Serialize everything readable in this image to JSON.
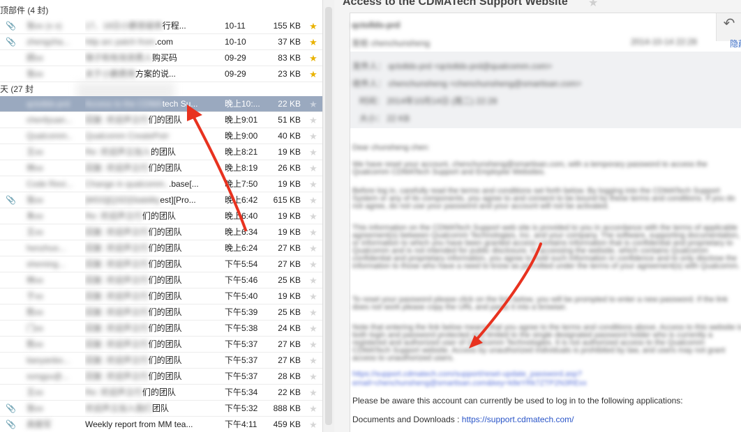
{
  "mail_list": {
    "groups": [
      {
        "label": "顶部件 (4 封)"
      },
      {
        "label": "天 (27 封"
      }
    ],
    "rows": [
      {
        "attach": true,
        "sender": "张xx (x x)",
        "subject_blur": "17、18日小鹏答疑表",
        "subject": "行程...",
        "date": "10-11",
        "size": "155 KB",
        "star": true
      },
      {
        "attach": true,
        "sender": "zhengzha...",
        "subject_blur": "http arc patch from",
        "subject": ".com",
        "date": "10-10",
        "size": "37 KB",
        "star": true
      },
      {
        "attach": false,
        "sender": "顾xx",
        "subject_blur": "锦子和有效资费人",
        "subject": "购买码",
        "date": "09-29",
        "size": "83 KB",
        "star": true
      },
      {
        "attach": false,
        "sender": "张xx",
        "subject_blur": "关于小鹏费用",
        "subject": "方案的说...",
        "date": "09-29",
        "size": "23 KB",
        "star": true
      },
      {
        "attach": false,
        "sender": "qctollds-prd",
        "subject_blur": "Access to the CDMA",
        "subject": "tech Su...",
        "date": "晚上10:...",
        "size": "22 KB",
        "star": false,
        "selected": true
      },
      {
        "attach": false,
        "sender": "chenfyuan...",
        "subject_blur": "回复: 欢迎声立行",
        "subject": "们的团队",
        "date": "晚上9:01",
        "size": "51 KB",
        "star": false
      },
      {
        "attach": false,
        "sender": "Qualcomm...",
        "subject_blur": "Qualcomm CreatePoint中的...",
        "subject": "",
        "date": "晚上9:00",
        "size": "40 KB",
        "star": false
      },
      {
        "attach": false,
        "sender": "王xx",
        "subject_blur": "Re: 欢迎声立加入",
        "subject": "的团队",
        "date": "晚上8:21",
        "size": "19 KB",
        "star": false
      },
      {
        "attach": false,
        "sender": "林xx",
        "subject_blur": "回复: 欢迎声立行",
        "subject": "们的团队",
        "date": "晚上8:19",
        "size": "26 KB",
        "star": false
      },
      {
        "attach": false,
        "sender": "Code Revi...",
        "subject_blur": "Change in qualcomm...",
        "subject": ".base[...",
        "date": "晚上7:50",
        "size": "19 KB",
        "star": false
      },
      {
        "attach": true,
        "sender": "张xx",
        "subject_blur": "[MSS][QSD]Stability",
        "subject": "est][Pro...",
        "date": "晚上6:42",
        "size": "615 KB",
        "star": false
      },
      {
        "attach": false,
        "sender": "朱xx",
        "subject_blur": "Re: 欢迎声立行",
        "subject": "们的团队",
        "date": "晚上6:40",
        "size": "19 KB",
        "star": false
      },
      {
        "attach": false,
        "sender": "王xx",
        "subject_blur": "回复: 欢迎声立行",
        "subject": "们的团队",
        "date": "晚上6:34",
        "size": "19 KB",
        "star": false
      },
      {
        "attach": false,
        "sender": "henzhuo...",
        "subject_blur": "回复: 欢迎声立行",
        "subject": "们的团队",
        "date": "晚上6:24",
        "size": "27 KB",
        "star": false
      },
      {
        "attach": false,
        "sender": "sheming...",
        "subject_blur": "回复: 欢迎声立行",
        "subject": "们的团队",
        "date": "下午5:54",
        "size": "27 KB",
        "star": false
      },
      {
        "attach": false,
        "sender": "林xx",
        "subject_blur": "回复: 欢迎声立行",
        "subject": "们的团队",
        "date": "下午5:46",
        "size": "25 KB",
        "star": false
      },
      {
        "attach": false,
        "sender": "于xx",
        "subject_blur": "回复: 欢迎声立行",
        "subject": "们的团队",
        "date": "下午5:40",
        "size": "19 KB",
        "star": false
      },
      {
        "attach": false,
        "sender": "陈xx",
        "subject_blur": "回复: 欢迎声立行",
        "subject": "们的团队",
        "date": "下午5:39",
        "size": "25 KB",
        "star": false
      },
      {
        "attach": false,
        "sender": "门xx",
        "subject_blur": "回复: 欢迎声立行",
        "subject": "们的团队",
        "date": "下午5:38",
        "size": "24 KB",
        "star": false
      },
      {
        "attach": false,
        "sender": "陈xx",
        "subject_blur": "回复: 欢迎声立行",
        "subject": "们的团队",
        "date": "下午5:37",
        "size": "27 KB",
        "star": false
      },
      {
        "attach": false,
        "sender": "tianyanbo...",
        "subject_blur": "回复: 欢迎声立行",
        "subject": "们的团队",
        "date": "下午5:37",
        "size": "27 KB",
        "star": false
      },
      {
        "attach": false,
        "sender": "songyu@...",
        "subject_blur": "回复: 欢迎声立行",
        "subject": "们的团队",
        "date": "下午5:37",
        "size": "28 KB",
        "star": false
      },
      {
        "attach": false,
        "sender": "王xx",
        "subject_blur": "Re: 欢迎声立行",
        "subject": "们的团队",
        "date": "下午5:34",
        "size": "22 KB",
        "star": false
      },
      {
        "attach": true,
        "sender": "张xx",
        "subject_blur": "欢迎声立加入我们",
        "subject": "团队",
        "date": "下午5:32",
        "size": "888 KB",
        "star": false
      },
      {
        "attach": true,
        "sender": "高振军",
        "subject_blur": "",
        "subject": "Weekly report from MM tea...",
        "date": "下午4:11",
        "size": "459 KB",
        "star": false
      }
    ]
  },
  "preview": {
    "title": "Access to the CDMATech Support Website",
    "from_blur": "qctollds-prd",
    "to_blur": "发给 chenchunsheng",
    "date_blur": "2014-10-14 22:28",
    "chn_link": "隐藏信",
    "meta_blur": [
      "发件人：  qctollds-prd <qctollds-prd@qualcomm.com>",
      "收件人：  chenchunsheng <chenchunsheng@smartisan.com>",
      "时间：  2014年10月14日 (周二) 22:28",
      "大小：  22 KB"
    ],
    "body_blur": [
      "Dear chunsheng chen:",
      "We have reset your account, chenchunsheng@smartisan.com, with a temporary password to access the Qualcomm CDMATech Support and Employee Websites.",
      "Before log in, carefully read the terms and conditions set forth below. By logging into the CDMATech Support System or any of its components, you agree to and consent to be bound by these terms and conditions. If you do not agree, do not use your password and your account will not be activated.",
      "This information on the CDMATech Support web site is provided to you in accordance with the terms of applicable agreement(s) between Qualcomm Technologies, Inc. and your company. The software, supporting documentation, or information to which you have been granted access contains information that is confidential and proprietary to Qualcomm and is not intended for public disclosure. In accessing the website, which contains Qualcomm confidential and proprietary information, you agree to hold such information in confidence and to only disclose the information to those who have a need to know as permitted under the terms of your agreement(s) with Qualcomm.",
      "To reset your password please click on the link below, you will be prompted to enter a new password. If the link does not work please copy the URL and paste it into a browser.",
      "Note that entering the link below means that you agree to the terms and conditions above. Access to this website is both login and password protected and limited to the single designated password holder who is currently a registered and authorized user of Qualcomm Technologies. It is not authorized access to the Qualcomm CDMATech Support website. Access by unauthorized individuals is prohibited by law, and users may not grant access to unauthorized users."
    ],
    "link_blur": [
      "https://support.cdmatech.com/support/reset-update_password.asp?",
      "email=chenchunsheng@smartisan.com&key=k8eYRk7ZTP2N3RExx"
    ],
    "line1": "Please be aware this account can currently be used to log in to the following applications:",
    "line2_label": "Documents and Downloads :",
    "line2_link": "https://support.cdmatech.com/"
  },
  "colors": {
    "selected_row": "#9aa9bf",
    "star_on": "#e9b200",
    "arrow": "#e8321f",
    "link": "#2a55c8"
  },
  "icons": {
    "attach": "paperclip-icon",
    "star": "star-icon",
    "reply": "reply-icon",
    "arrow": "red-annotation-arrow"
  }
}
